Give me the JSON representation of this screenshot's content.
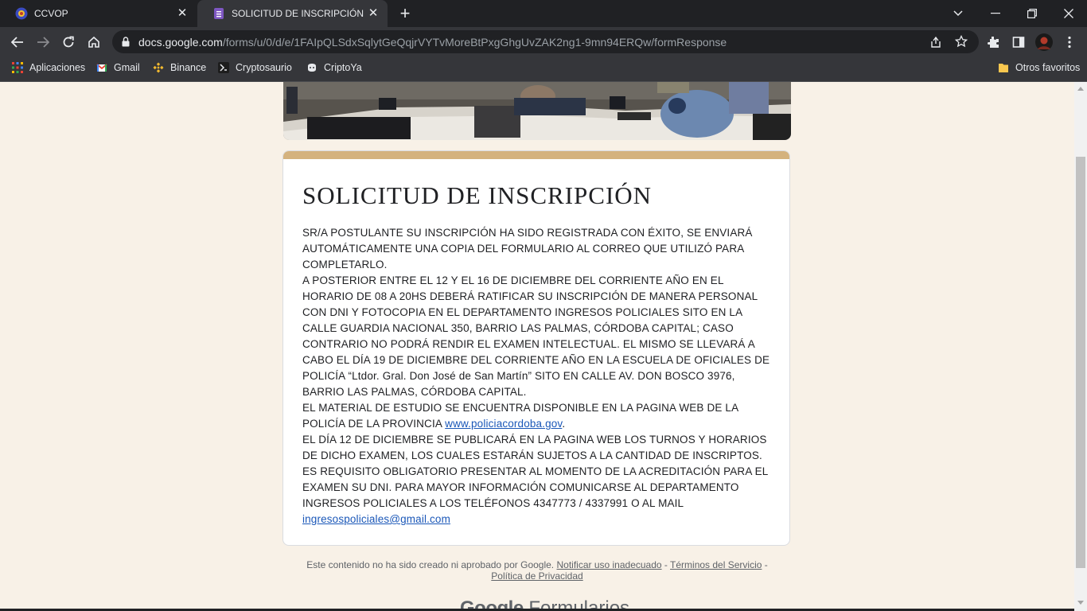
{
  "browser": {
    "tabs": [
      {
        "title": "CCVOP",
        "active": false
      },
      {
        "title": "SOLICITUD DE INSCRIPCIÓN",
        "active": true
      }
    ],
    "url_host": "docs.google.com",
    "url_path": "/forms/u/0/d/e/1FAIpQLSdxSqlytGeQqjrVYTvMoreBtPxgGhgUvZAK2ng1-9mn94ERQw/formResponse",
    "bookmarks": [
      {
        "label": "Aplicaciones",
        "icon": "apps-grid-icon"
      },
      {
        "label": "Gmail",
        "icon": "gmail-icon"
      },
      {
        "label": "Binance",
        "icon": "binance-icon"
      },
      {
        "label": "Cryptosaurio",
        "icon": "cryptosaurio-icon"
      },
      {
        "label": "CriptoYa",
        "icon": "criptoya-icon"
      }
    ],
    "other_bookmarks": "Otros favoritos"
  },
  "form": {
    "title": "SOLICITUD DE INSCRIPCIÓN",
    "paragraphs": {
      "p1": "SR/A POSTULANTE SU INSCRIPCIÓN HA SIDO REGISTRADA CON ÉXITO, SE ENVIARÁ AUTOMÁTICAMENTE UNA COPIA DEL FORMULARIO AL CORREO QUE UTILIZÓ PARA COMPLETARLO.",
      "p2": "A POSTERIOR ENTRE EL 12 Y EL 16 DE DICIEMBRE DEL CORRIENTE AÑO EN EL HORARIO DE 08 A 20HS DEBERÁ RATIFICAR SU INSCRIPCIÓN DE MANERA PERSONAL CON DNI Y FOTOCOPIA EN EL DEPARTAMENTO INGRESOS POLICIALES SITO EN LA CALLE GUARDIA NACIONAL 350, BARRIO LAS PALMAS, CÓRDOBA CAPITAL; CASO CONTRARIO NO PODRÁ RENDIR EL EXAMEN INTELECTUAL. EL MISMO SE LLEVARÁ A CABO EL DÍA 19 DE DICIEMBRE DEL CORRIENTE AÑO EN LA ESCUELA DE OFICIALES DE POLICÍA “Ltdor. Gral. Don José de San Martín” SITO EN CALLE AV. DON BOSCO 3976, BARRIO LAS PALMAS, CÓRDOBA CAPITAL.",
      "p3_text": "EL MATERIAL DE ESTUDIO SE ENCUENTRA DISPONIBLE EN LA PAGINA WEB DE LA POLICÍA DE LA PROVINCIA ",
      "p3_link": "www.policiacordoba.gov",
      "p3_end": ".",
      "p4_text": "EL DÍA 12 DE DICIEMBRE SE PUBLICARÁ EN LA PAGINA WEB LOS TURNOS Y HORARIOS DE DICHO EXAMEN, LOS CUALES ESTARÁN SUJETOS A LA CANTIDAD DE INSCRIPTOS. ES REQUISITO OBLIGATORIO PRESENTAR AL MOMENTO DE LA ACREDITACIÓN PARA EL EXAMEN SU DNI. PARA MAYOR INFORMACIÓN COMUNICARSE AL DEPARTAMENTO INGRESOS POLICIALES A LOS TELÉFONOS 4347773 / 4337991 O AL MAIL ",
      "p4_link": "ingresospoliciales@gmail.com"
    }
  },
  "footer": {
    "disclaimer": "Este contenido no ha sido creado ni aprobado por Google. ",
    "report_link": "Notificar uso inadecuado",
    "sep1": " - ",
    "terms_link": "Términos del Servicio",
    "sep2": " - ",
    "privacy_link": "Política de Privacidad",
    "brand_google": "Google",
    "brand_product": "Formularios"
  },
  "colors": {
    "page_bg": "#f8f1e7",
    "accent": "#d4b27e",
    "link": "#1a57b8"
  }
}
